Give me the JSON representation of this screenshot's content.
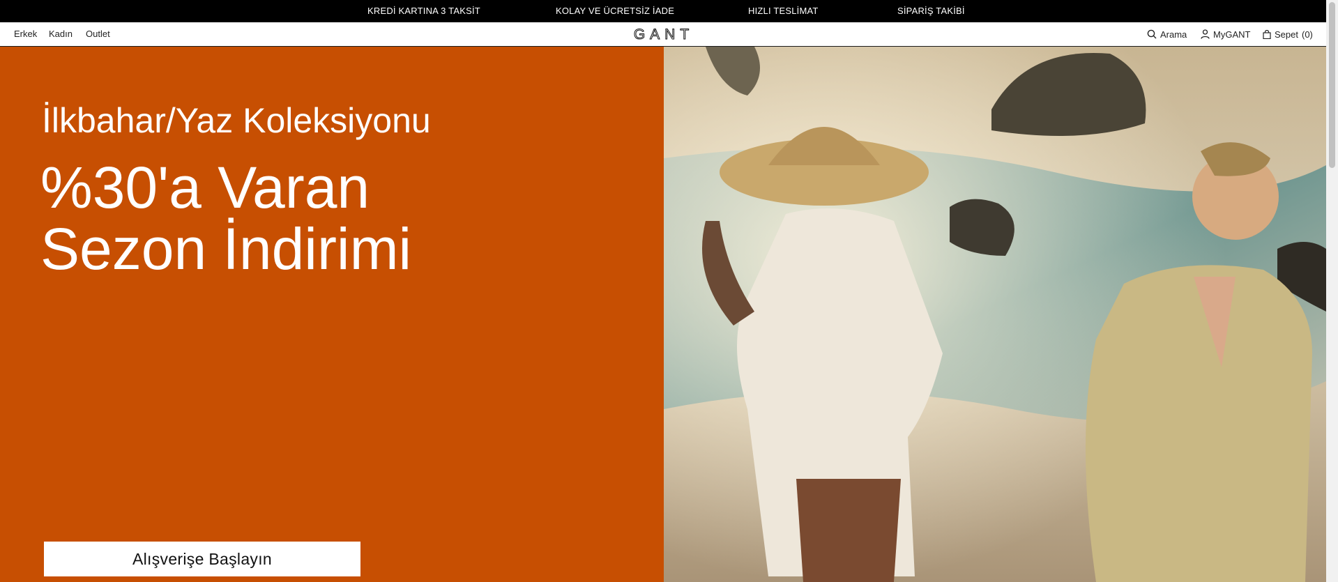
{
  "announcement": {
    "items": [
      "KREDİ KARTINA 3 TAKSİT",
      "KOLAY VE ÜCRETSİZ İADE",
      "HIZLI TESLİMAT",
      "SİPARİŞ TAKİBİ"
    ]
  },
  "header": {
    "nav": [
      "Erkek",
      "Kadın",
      "Outlet"
    ],
    "logo": "GANT",
    "search_label": "Arama",
    "account_label": "MyGANT",
    "cart_label": "Sepet",
    "cart_count": "(0)"
  },
  "hero": {
    "eyebrow": "İlkbahar/Yaz Koleksiyonu",
    "title_line1": "%30'a Varan",
    "title_line2": "Sezon İndirimi",
    "cta_label": "Alışverişe Başlayın",
    "background_color": "#c74f02",
    "image_subject": "beach-fashion-photo"
  },
  "icons": {
    "search": "search-icon",
    "account": "user-icon",
    "cart": "bag-icon"
  }
}
